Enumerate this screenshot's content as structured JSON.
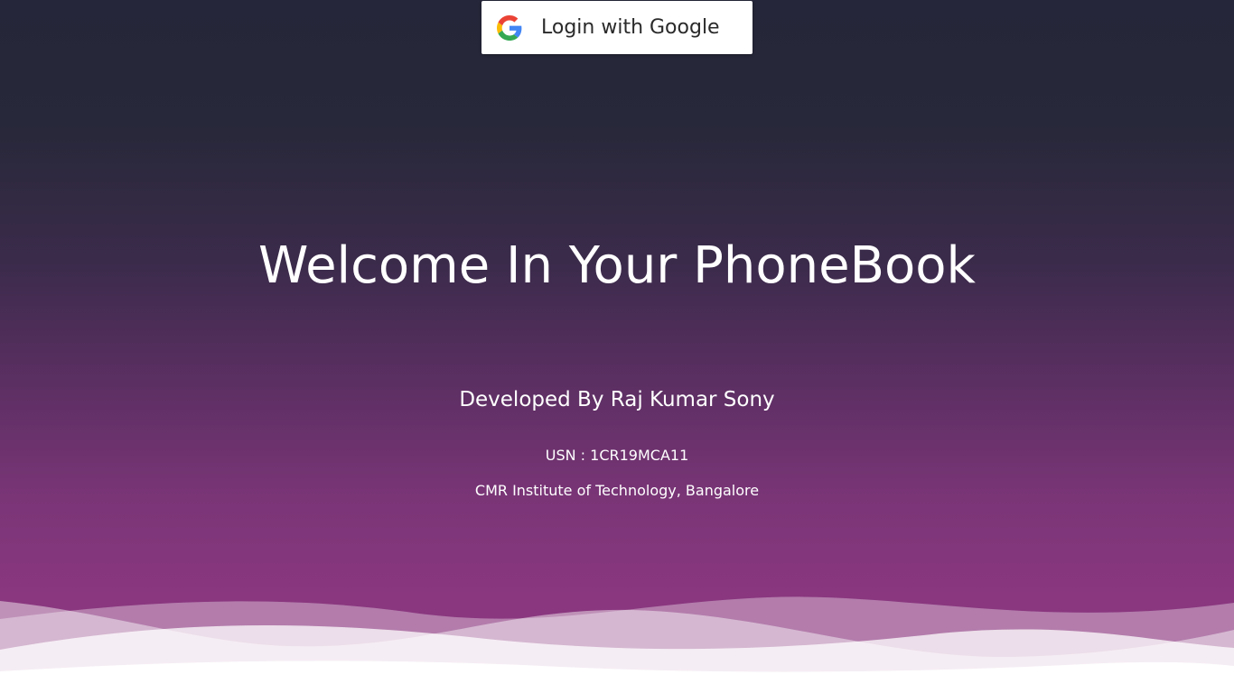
{
  "login_button": {
    "label": "Login with Google",
    "icon": "google-g-logo-icon"
  },
  "hero": {
    "title": "Welcome In Your PhoneBook",
    "developer": "Developed By Raj Kumar Sony",
    "usn": "USN : 1CR19MCA11",
    "institute": "CMR Institute of Technology, Bangalore"
  },
  "colors": {
    "background_top": "#252639",
    "background_bottom": "#8a377f",
    "wave_light": "#ffffff",
    "google_blue": "#4285F4",
    "google_red": "#EA4335",
    "google_yellow": "#FBBC05",
    "google_green": "#34A853"
  }
}
